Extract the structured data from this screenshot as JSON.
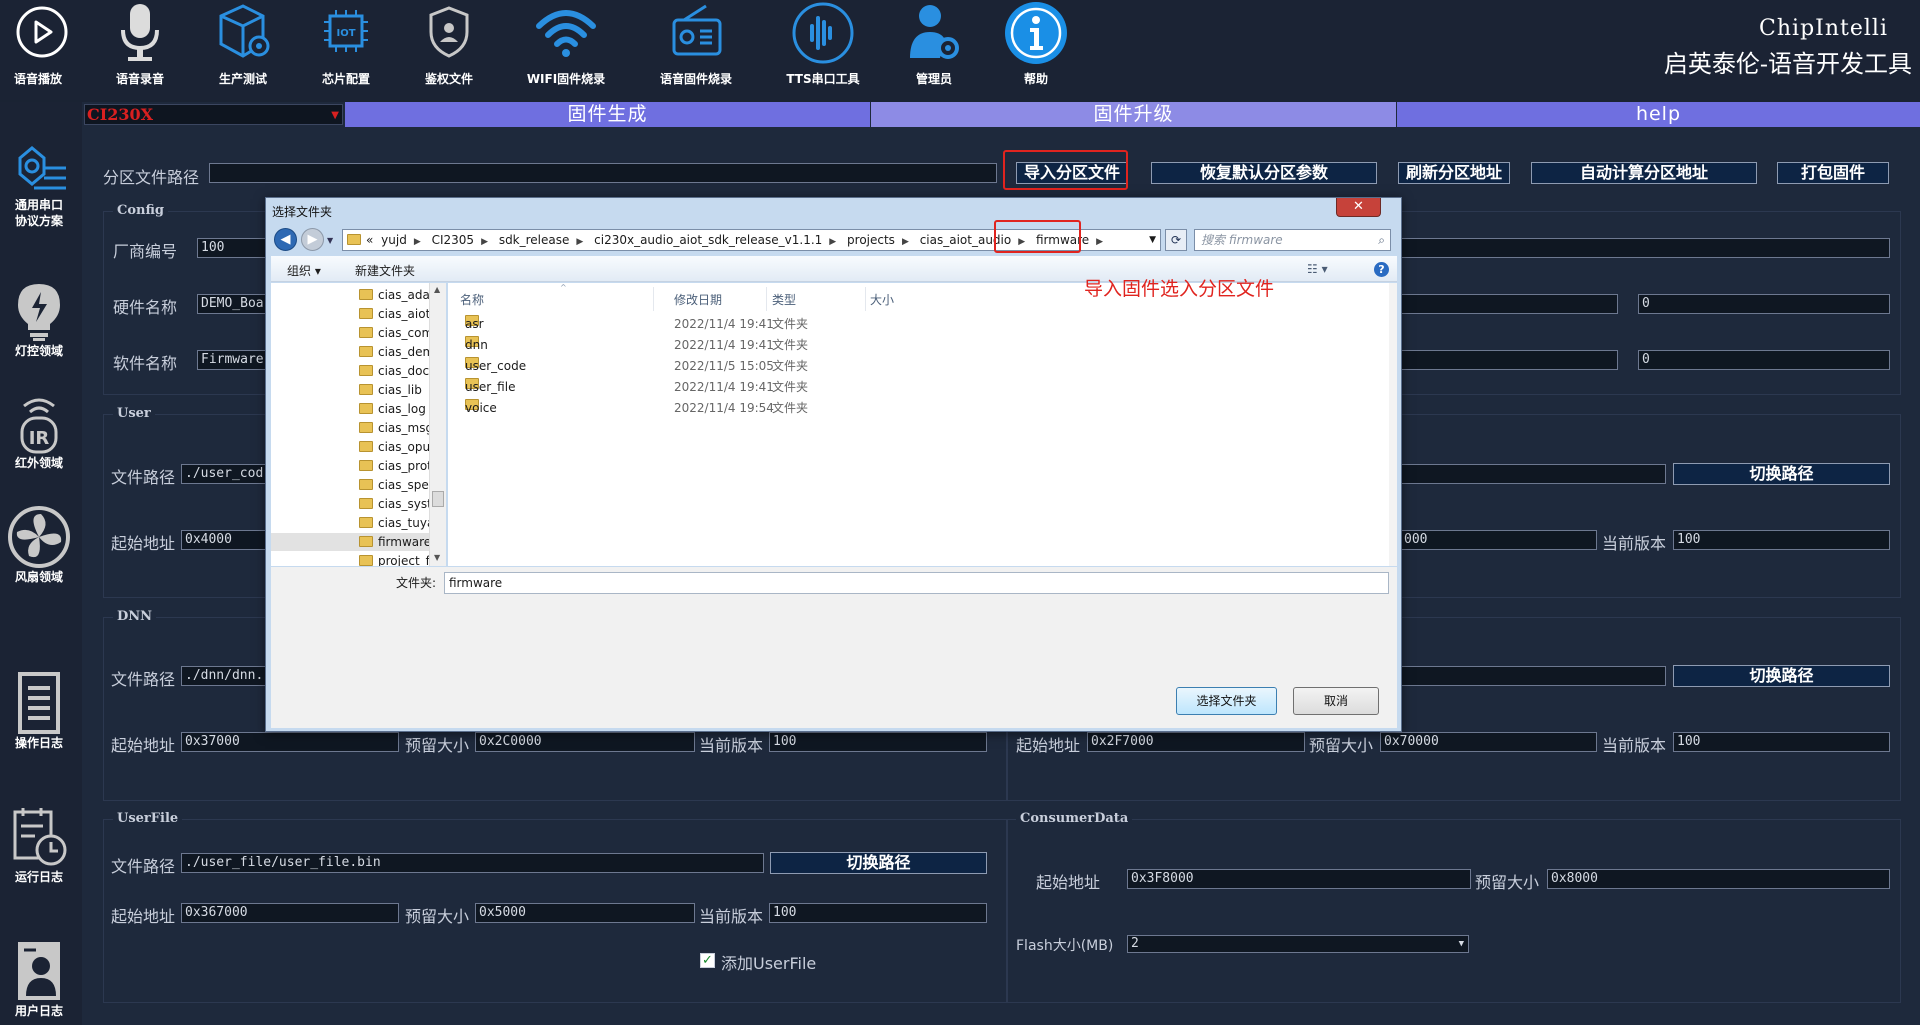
{
  "toolbar": {
    "items": [
      {
        "label": "语音播放",
        "icon": "play-circle-icon"
      },
      {
        "label": "语音录音",
        "icon": "microphone-icon"
      },
      {
        "label": "生产测试",
        "icon": "box-gear-icon"
      },
      {
        "label": "芯片配置",
        "icon": "iot-chip-icon"
      },
      {
        "label": "鉴权文件",
        "icon": "shield-user-icon"
      },
      {
        "label": "WIFI固件烧录",
        "icon": "wifi-icon"
      },
      {
        "label": "语音固件烧录",
        "icon": "radio-icon"
      },
      {
        "label": "TTS串口工具",
        "icon": "voice-wave-icon"
      },
      {
        "label": "管理员",
        "icon": "admin-gear-icon"
      },
      {
        "label": "帮助",
        "icon": "info-icon"
      }
    ]
  },
  "brand": {
    "line1": "ChipIntelli",
    "line2": "启英泰伦-语音开发工具"
  },
  "sidebar": {
    "items": [
      {
        "label1": "通用串口",
        "label2": "协议方案",
        "icon": "serial-protocol-icon"
      },
      {
        "label1": "灯控领域",
        "label2": "",
        "icon": "bulb-icon"
      },
      {
        "label1": "红外领域",
        "label2": "",
        "icon": "infrared-icon"
      },
      {
        "label1": "风扇领域",
        "label2": "",
        "icon": "fan-icon"
      },
      {
        "label1": "操作日志",
        "label2": "",
        "icon": "list-icon"
      },
      {
        "label1": "运行日志",
        "label2": "",
        "icon": "clock-log-icon"
      },
      {
        "label1": "用户日志",
        "label2": "",
        "icon": "user-log-icon"
      }
    ]
  },
  "chip_select": {
    "value": "CI230X"
  },
  "tabs": [
    {
      "label": "固件生成"
    },
    {
      "label": "固件升级"
    },
    {
      "label": "help"
    }
  ],
  "partition": {
    "label": "分区文件路径",
    "path": "",
    "import_btn": "导入分区文件",
    "restore_btn": "恢复默认分区参数",
    "refresh_btn": "刷新分区地址",
    "auto_btn": "自动计算分区地址",
    "pack_btn": "打包固件"
  },
  "config": {
    "title": "Config",
    "vendor_label": "厂商编号",
    "vendor_value": "100",
    "hw_label": "硬件名称",
    "hw_value": "DEMO_Boa",
    "sw_label": "软件名称",
    "sw_value": "Firmware",
    "r_hw_value": "0",
    "r_sw_value": "0"
  },
  "user": {
    "title": "User",
    "path_label": "文件路径",
    "path_value": "./user_cod",
    "start_label": "起始地址",
    "start_value": "0x4000",
    "switch_btn": "切换路径",
    "r_start_value": "000",
    "ver_label": "当前版本",
    "ver_value": "100"
  },
  "dnn": {
    "title": "DNN",
    "path_label": "文件路径",
    "path_value": "./dnn/dnn.",
    "start_label": "起始地址",
    "start_value": "0x37000",
    "size_label": "预留大小",
    "size_value": "0x2C0000",
    "ver_label": "当前版本",
    "ver_value": "100",
    "switch_btn": "切换路径",
    "r_start_label": "起始地址",
    "r_start_value": "0x2F7000",
    "r_size_label": "预留大小",
    "r_size_value": "0x70000",
    "r_ver_label": "当前版本",
    "r_ver_value": "100"
  },
  "userfile": {
    "title": "UserFile",
    "path_label": "文件路径",
    "path_value": "./user_file/user_file.bin",
    "switch_btn": "切换路径",
    "start_label": "起始地址",
    "start_value": "0x367000",
    "size_label": "预留大小",
    "size_value": "0x5000",
    "ver_label": "当前版本",
    "ver_value": "100",
    "checkbox_label": "添加UserFile"
  },
  "consumer": {
    "title": "ConsumerData",
    "start_label": "起始地址",
    "start_value": "0x3F8000",
    "size_label": "预留大小",
    "size_value": "0x8000",
    "flash_label": "Flash大小(MB)",
    "flash_value": "2"
  },
  "dialog": {
    "title": "选择文件夹",
    "close": "✕",
    "path_prefix": "«",
    "path": [
      "yujd",
      "CI2305",
      "sdk_release",
      "ci230x_audio_aiot_sdk_release_v1.1.1",
      "projects",
      "cias_aiot_audio",
      "firmware"
    ],
    "search_placeholder": "搜索 firmware",
    "organize": "组织 ▾",
    "new_folder": "新建文件夹",
    "tree": [
      "cias_adapte",
      "cias_aiot_cfg",
      "cias_commo",
      "cias_demo",
      "cias_doc",
      "cias_lib",
      "cias_log",
      "cias_msg_ha",
      "cias_opus",
      "cias_protoc",
      "cias_speex",
      "cias_system",
      "cias_tuya_ir_",
      "firmware",
      "project_file"
    ],
    "columns": {
      "name": "名称",
      "date": "修改日期",
      "type": "类型",
      "size": "大小"
    },
    "files": [
      {
        "name": "asr",
        "date": "2022/11/4 19:41",
        "type": "文件夹"
      },
      {
        "name": "dnn",
        "date": "2022/11/4 19:41",
        "type": "文件夹"
      },
      {
        "name": "user_code",
        "date": "2022/11/5 15:05",
        "type": "文件夹"
      },
      {
        "name": "user_file",
        "date": "2022/11/4 19:41",
        "type": "文件夹"
      },
      {
        "name": "voice",
        "date": "2022/11/4 19:54",
        "type": "文件夹"
      }
    ],
    "folder_label": "文件夹:",
    "folder_value": "firmware",
    "select_btn": "选择文件夹",
    "cancel_btn": "取消"
  },
  "annotation": "导入固件选入分区文件",
  "colors": {
    "accent_tab": "#8d8be5",
    "tab": "#6f6fe0",
    "bg": "#1e293c",
    "red": "#e0241f"
  }
}
